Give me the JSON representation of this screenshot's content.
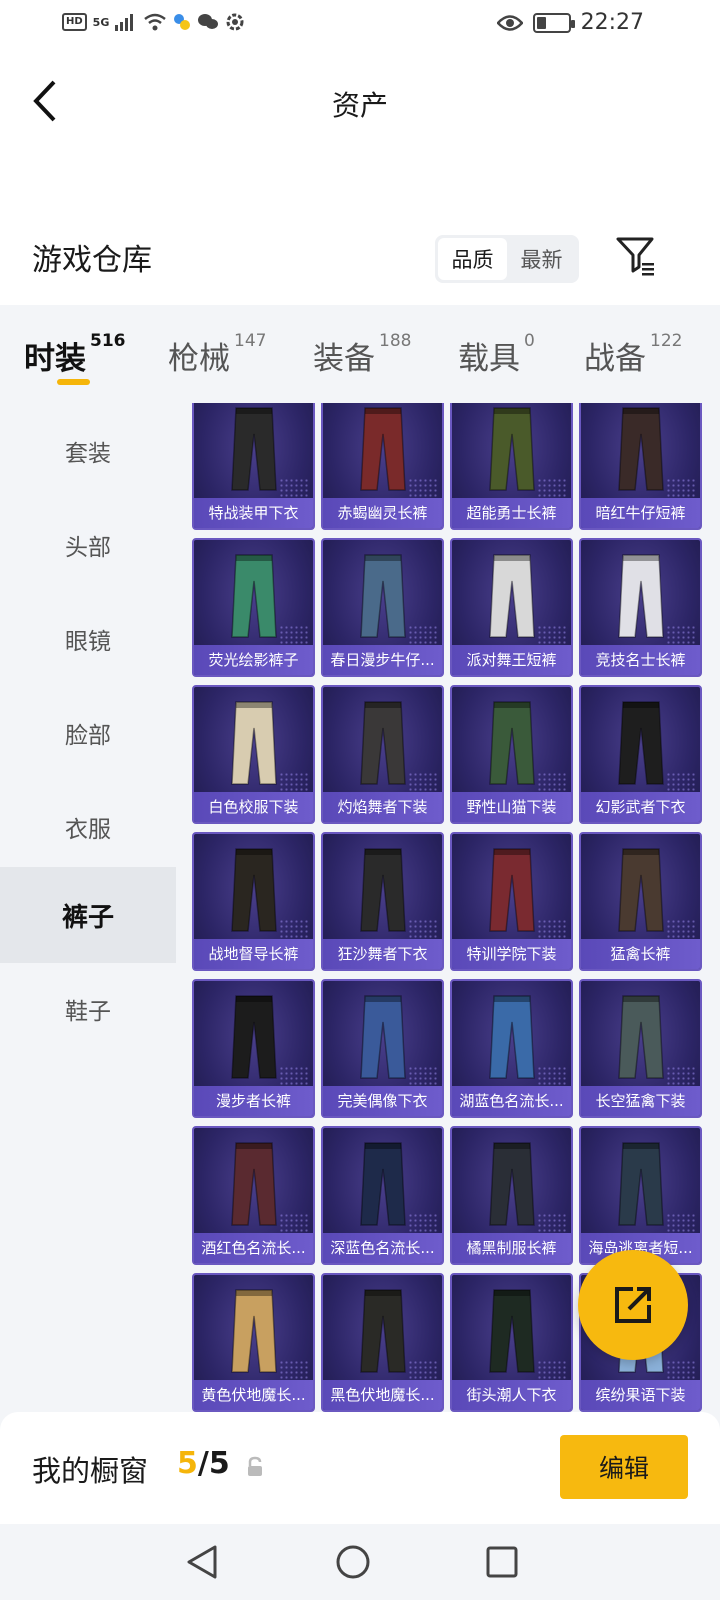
{
  "status_bar": {
    "hd": "HD",
    "network": "5G",
    "time": "22:27"
  },
  "nav": {
    "title": "资产"
  },
  "warehouse": {
    "title": "游戏仓库",
    "sort_options": [
      "品质",
      "最新"
    ],
    "active_sort": "品质"
  },
  "category_tabs": [
    {
      "label": "时装",
      "count": "516"
    },
    {
      "label": "枪械",
      "count": "147"
    },
    {
      "label": "装备",
      "count": "188"
    },
    {
      "label": "载具",
      "count": "0"
    },
    {
      "label": "战备",
      "count": "122"
    }
  ],
  "sidebar": {
    "items": [
      "套装",
      "头部",
      "眼镜",
      "脸部",
      "衣服",
      "裤子",
      "鞋子"
    ],
    "active": "裤子"
  },
  "items": [
    {
      "name": "特战装甲下衣",
      "color": "#2a2a2a"
    },
    {
      "name": "赤蝎幽灵长裤",
      "color": "#7a2a2a"
    },
    {
      "name": "超能勇士长裤",
      "color": "#4a5a2a"
    },
    {
      "name": "暗红牛仔短裤",
      "color": "#3a2a28"
    },
    {
      "name": "荧光绘影裤子",
      "color": "#3a8a6a"
    },
    {
      "name": "春日漫步牛仔...",
      "color": "#4a6a8a"
    },
    {
      "name": "派对舞王短裤",
      "color": "#d8d8d8"
    },
    {
      "name": "竞技名士长裤",
      "color": "#e0e0e6"
    },
    {
      "name": "白色校服下装",
      "color": "#d8ccb0"
    },
    {
      "name": "灼焰舞者下装",
      "color": "#3a3838"
    },
    {
      "name": "野性山猫下装",
      "color": "#3a5a3a"
    },
    {
      "name": "幻影武者下衣",
      "color": "#1e1e1e"
    },
    {
      "name": "战地督导长裤",
      "color": "#2a2620"
    },
    {
      "name": "狂沙舞者下衣",
      "color": "#2a2a2a"
    },
    {
      "name": "特训学院下装",
      "color": "#7a2a30"
    },
    {
      "name": "猛禽长裤",
      "color": "#4a3a30"
    },
    {
      "name": "漫步者长裤",
      "color": "#1c1c1c"
    },
    {
      "name": "完美偶像下衣",
      "color": "#3a5a9a"
    },
    {
      "name": "湖蓝色名流长...",
      "color": "#3a6aa8"
    },
    {
      "name": "长空猛禽下装",
      "color": "#4a5a5a"
    },
    {
      "name": "酒红色名流长...",
      "color": "#5a2a30"
    },
    {
      "name": "深蓝色名流长...",
      "color": "#1e2a4a"
    },
    {
      "name": "橘黑制服长裤",
      "color": "#2a2e36"
    },
    {
      "name": "海岛逃离者短...",
      "color": "#2a3a4a"
    },
    {
      "name": "黄色伏地魔长...",
      "color": "#c8a060"
    },
    {
      "name": "黑色伏地魔长...",
      "color": "#2a2a26"
    },
    {
      "name": "街头潮人下衣",
      "color": "#1e2a22"
    },
    {
      "name": "缤纷果语下装",
      "color": "#8ab0d8"
    }
  ],
  "bottom": {
    "label": "我的橱窗",
    "current": "5",
    "separator": "/",
    "total": "5",
    "edit_label": "编辑"
  },
  "colors": {
    "accent": "#f7b90f",
    "card_bg": "#2c2566",
    "card_label": "#6e5ccc"
  }
}
